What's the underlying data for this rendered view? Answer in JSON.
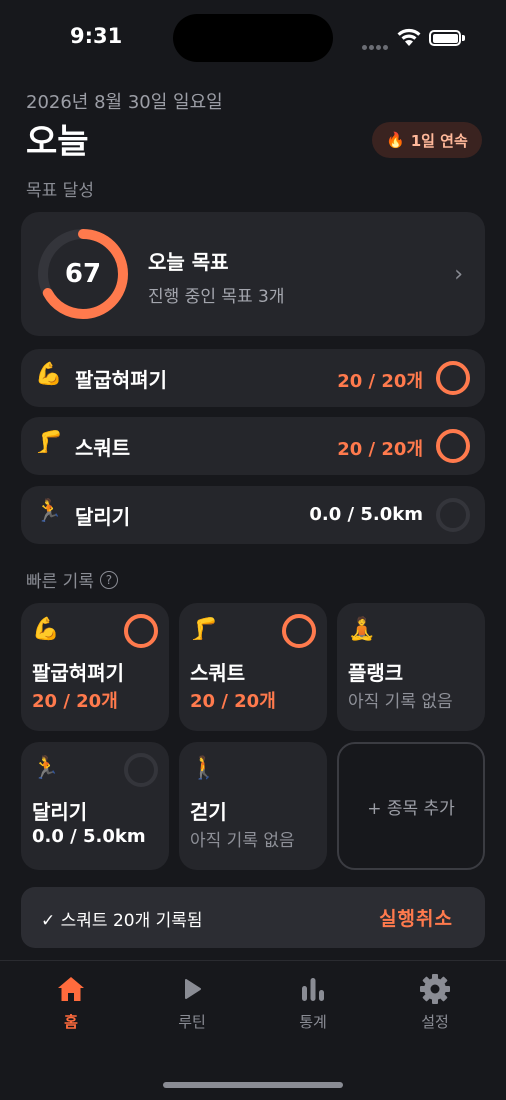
{
  "status_bar": {
    "time": "9:31"
  },
  "header": {
    "date": "2026년 8월 30일 일요일",
    "title": "오늘",
    "streak_emoji": "🔥",
    "streak_label": "1일 연속"
  },
  "goal_section": {
    "label": "목표 달성",
    "percent": "67",
    "percent_value": 0.67,
    "title": "오늘 목표",
    "subtitle": "진행 중인 목표 3개"
  },
  "exercises": [
    {
      "emoji": "💪",
      "name": "팔굽혀펴기",
      "progress": "20 / 20개",
      "completion": 1.0
    },
    {
      "emoji": "🦵",
      "name": "스쿼트",
      "progress": "20 / 20개",
      "completion": 1.0
    },
    {
      "emoji": "🏃",
      "name": "달리기",
      "progress": "0.0 / 5.0km",
      "completion": 0.0
    }
  ],
  "quick_section": {
    "label": "빠른 기록",
    "help_icon": "?",
    "items": [
      {
        "emoji": "💪",
        "name": "팔굽혀펴기",
        "value": "20 / 20개",
        "completion": 1.0
      },
      {
        "emoji": "🦵",
        "name": "스쿼트",
        "value": "20 / 20개",
        "completion": 1.0
      },
      {
        "emoji": "🧘",
        "name": "플랭크",
        "value": "아직 기록 없음"
      },
      {
        "emoji": "🏃",
        "name": "달리기",
        "value": "0.0 / 5.0km",
        "completion": 0.0
      },
      {
        "emoji": "🚶",
        "name": "걷기",
        "value": "아직 기록 없음"
      }
    ],
    "add_label": "+ 종목 추가"
  },
  "toast": {
    "message": "✓ 스쿼트 20개 기록됨",
    "undo_label": "실행취소"
  },
  "tabs": [
    {
      "label": "홈",
      "icon": "home-icon",
      "active": true
    },
    {
      "label": "루틴",
      "icon": "play-icon",
      "active": false
    },
    {
      "label": "통계",
      "icon": "bar-chart-icon",
      "active": false
    },
    {
      "label": "설정",
      "icon": "gear-icon",
      "active": false
    }
  ],
  "colors": {
    "accent": "#ff7a4d",
    "background": "#17181c",
    "card": "#25262b",
    "ring_track": "#34353b"
  }
}
